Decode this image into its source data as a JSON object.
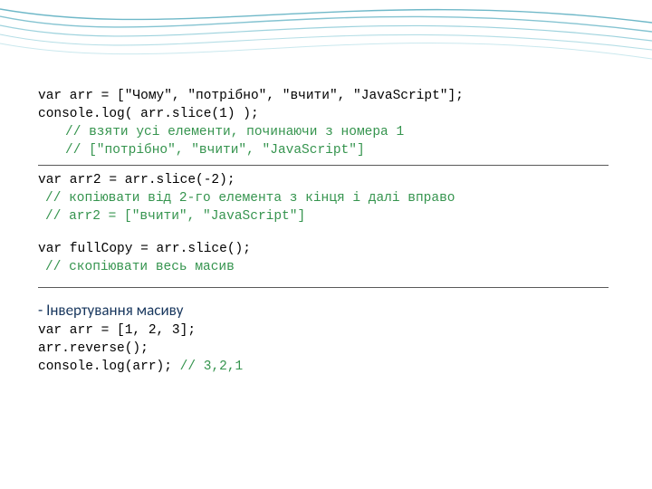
{
  "code1": {
    "l1": "var arr = [\"Чому\", \"потрібно\", \"вчити\", \"JavaScript\"];",
    "l2": "console.log( arr.slice(1) );",
    "c1": "// взяти усі елементи, починаючи з номера 1",
    "c2": "// [\"потрібно\", \"вчити\", \"JavaScript\"]"
  },
  "code2": {
    "l1": "var arr2 = arr.slice(-2);",
    "c1": "// копіювати від 2-го елемента з кінця і далі вправо",
    "c2": "// arr2 = [\"вчити\", \"JavaScript\"]"
  },
  "code3": {
    "l1": "var fullCopy = arr.slice();",
    "c1": "// скопіювати весь масив"
  },
  "section": {
    "dash": "- ",
    "title": "Інвертування масиву"
  },
  "code4": {
    "l1": "var arr = [1, 2, 3];",
    "l2": "arr.reverse();",
    "l3a": "console.log(arr); ",
    "l3b": "// 3,2,1"
  }
}
